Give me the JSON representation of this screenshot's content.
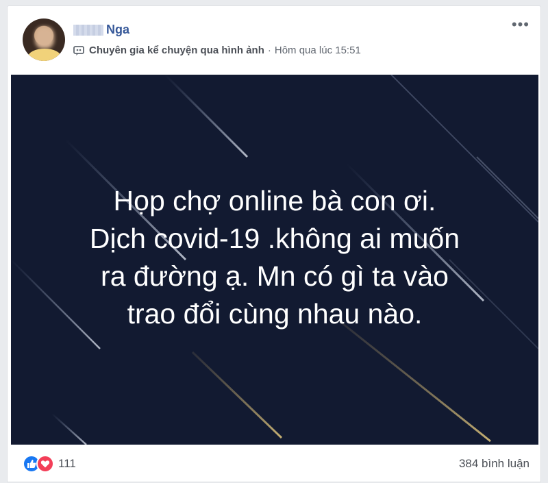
{
  "post": {
    "author": {
      "name": "Nga"
    },
    "meta": {
      "badge": "Chuyên gia kể chuyện qua hình ảnh",
      "separator": "·",
      "timestamp": "Hôm qua lúc 15:51"
    },
    "menu_icon": "more-horizontal-icon",
    "image_text": {
      "line1": "Họp chợ online bà con ơi.",
      "line2": "Dịch covid-19 .không ai muốn",
      "line3": "ra đường ạ. Mn có gì ta vào",
      "line4": "trao đổi cùng nhau nào."
    },
    "image_bg_color": "#121a31",
    "reactions": {
      "icons": [
        "like-icon",
        "love-icon"
      ],
      "count": "111"
    },
    "comments_label": "384 bình luận"
  },
  "colors": {
    "name": "#365899",
    "like": "#1877f2",
    "love": "#f33e58"
  }
}
